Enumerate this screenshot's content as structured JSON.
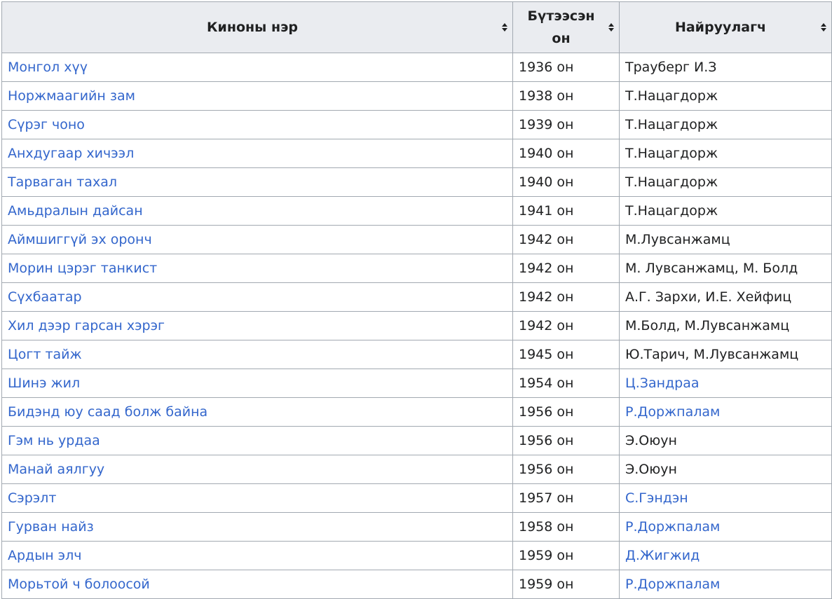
{
  "header": {
    "col_title": "Киноны нэр",
    "col_year": "Бүтээсэн он",
    "col_director": "Найруулагч"
  },
  "colors": {
    "link": "#3366cc",
    "header_bg": "#eaecf0",
    "border": "#a2a9b1",
    "text": "#202122"
  },
  "rows": [
    {
      "title": "Монгол хүү",
      "year": "1936 он",
      "director": "Трауберг И.З",
      "director_link": false
    },
    {
      "title": "Норжмаагийн зам",
      "year": "1938 он",
      "director": "Т.Нацагдорж",
      "director_link": false
    },
    {
      "title": "Сүрэг чоно",
      "year": "1939 он",
      "director": "Т.Нацагдорж",
      "director_link": false
    },
    {
      "title": "Анхдугаар хичээл",
      "year": "1940 он",
      "director": "Т.Нацагдорж",
      "director_link": false
    },
    {
      "title": "Тарваган тахал",
      "year": "1940 он",
      "director": "Т.Нацагдорж",
      "director_link": false
    },
    {
      "title": "Амьдралын дайсан",
      "year": "1941 он",
      "director": "Т.Нацагдорж",
      "director_link": false
    },
    {
      "title": "Аймшиггүй эх оронч",
      "year": "1942 он",
      "director": "М.Лувсанжамц",
      "director_link": false
    },
    {
      "title": "Морин цэрэг танкист",
      "year": "1942 он",
      "director": "М. Лувсанжамц, М. Болд",
      "director_link": false
    },
    {
      "title": "Сүхбаатар",
      "year": "1942 он",
      "director": "А.Г. Зархи, И.Е. Хейфиц",
      "director_link": false
    },
    {
      "title": "Хил дээр гарсан хэрэг",
      "year": "1942 он",
      "director": "М.Болд, М.Лувсанжамц",
      "director_link": false
    },
    {
      "title": "Цогт тайж",
      "year": "1945 он",
      "director": "Ю.Тарич, М.Лувсанжамц",
      "director_link": false
    },
    {
      "title": "Шинэ жил",
      "year": "1954 он",
      "director": "Ц.Зандраа",
      "director_link": true
    },
    {
      "title": "Бидэнд юу саад болж байна",
      "year": "1956 он",
      "director": "Р.Доржпалам",
      "director_link": true
    },
    {
      "title": "Гэм нь урдаа",
      "year": "1956 он",
      "director": "Э.Оюун",
      "director_link": false
    },
    {
      "title": "Манай аялгуу",
      "year": "1956 он",
      "director": "Э.Оюун",
      "director_link": false
    },
    {
      "title": "Сэрэлт",
      "year": "1957 он",
      "director": "С.Гэндэн",
      "director_link": true
    },
    {
      "title": "Гурван найз",
      "year": "1958 он",
      "director": "Р.Доржпалам",
      "director_link": true
    },
    {
      "title": "Ардын элч",
      "year": "1959 он",
      "director": "Д.Жигжид",
      "director_link": true
    },
    {
      "title": "Морьтой ч болоосой",
      "year": "1959 он",
      "director": "Р.Доржпалам",
      "director_link": true
    }
  ]
}
